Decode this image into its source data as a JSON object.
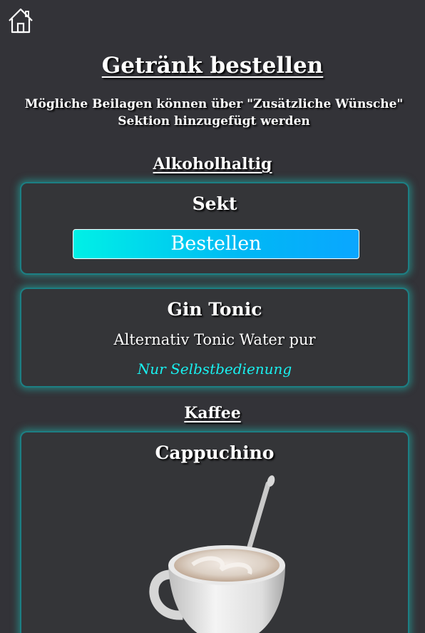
{
  "nav": {
    "home_icon": "home-icon"
  },
  "header": {
    "title": "Getränk bestellen",
    "subtitle": "Mögliche Beilagen können über \"Zusätzliche Wünsche\" Sektion hinzugefügt werden"
  },
  "sections": [
    {
      "heading": "Alkoholhaltig",
      "items": [
        {
          "name": "Sekt",
          "button_label": "Bestellen"
        },
        {
          "name": "Gin Tonic",
          "description": "Alternativ Tonic Water pur",
          "note": "Nur Selbstbedienung"
        }
      ]
    },
    {
      "heading": "Kaffee",
      "items": [
        {
          "name": "Cappuchino",
          "image": "cappuccino-cup-image"
        }
      ]
    }
  ],
  "colors": {
    "background": "#333338",
    "card_glow": "#20b2aa",
    "button_gradient_start": "#00f0e6",
    "button_gradient_end": "#0aa6ff",
    "note_text": "#19f0ef"
  }
}
